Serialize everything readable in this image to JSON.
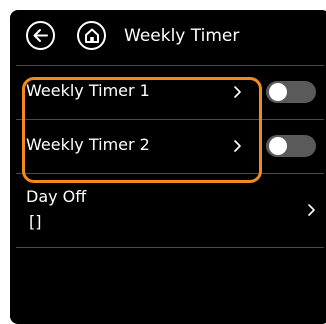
{
  "header": {
    "back_icon": "arrow-left-icon",
    "home_icon": "home-icon",
    "title": "Weekly Timer"
  },
  "rows": [
    {
      "label": "Weekly Timer 1",
      "toggle_on": false
    },
    {
      "label": "Weekly Timer 2",
      "toggle_on": false
    },
    {
      "label": "Day Off",
      "sub": "[]"
    }
  ],
  "colors": {
    "screen_background": "#000000",
    "text": "#ffffff",
    "divider": "#4a4a4a",
    "toggle_off_track": "#5a5a5a",
    "highlight_outline": "#f28a1e"
  }
}
